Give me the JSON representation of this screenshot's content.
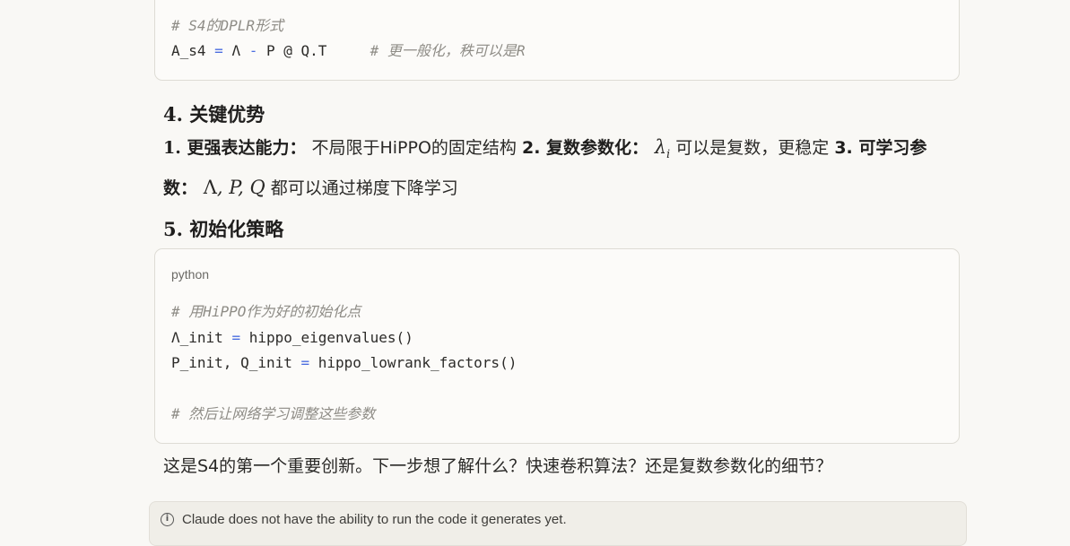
{
  "code_block_1": {
    "lines": [
      {
        "comment": "# S4的DPLR形式"
      },
      {
        "a": "A_s4 ",
        "op1": "=",
        "b": " Λ ",
        "op2": "-",
        "c": " P @ Q.T     ",
        "comment": "# 更一般化，秩可以是R"
      }
    ]
  },
  "section4": {
    "heading": "4. 关键优势",
    "item1_label": "1. 更强表达能力：",
    "item1_text": " 不局限于HiPPO的固定结构 ",
    "item2_label": "2. 复数参数化：",
    "item2_math": "λ",
    "item2_math_sub": "i",
    "item2_text": " 可以是复数，更稳定 ",
    "item3_label": "3. 可学习参数：",
    "item3_math_1": "Λ",
    "item3_math_2": ", P, Q",
    "item3_text": " 都可以通过梯度下降学习"
  },
  "section5": {
    "heading": "5. 初始化策略"
  },
  "code_block_2": {
    "language": "python",
    "line1_comment": "# 用HiPPO作为好的初始化点",
    "line2_a": "Λ_init ",
    "line2_op": "=",
    "line2_b": " hippo_eigenvalues()",
    "line3_a": "P_init, Q_init ",
    "line3_op": "=",
    "line3_b": " hippo_lowrank_factors()",
    "line5_comment": "# 然后让网络学习调整这些参数"
  },
  "closing_text": "这是S4的第一个重要创新。下一步想了解什么？快速卷积算法？还是复数参数化的细节？",
  "notice": {
    "icon": "info-icon",
    "text": "Claude does not have the ability to run the code it generates yet."
  }
}
